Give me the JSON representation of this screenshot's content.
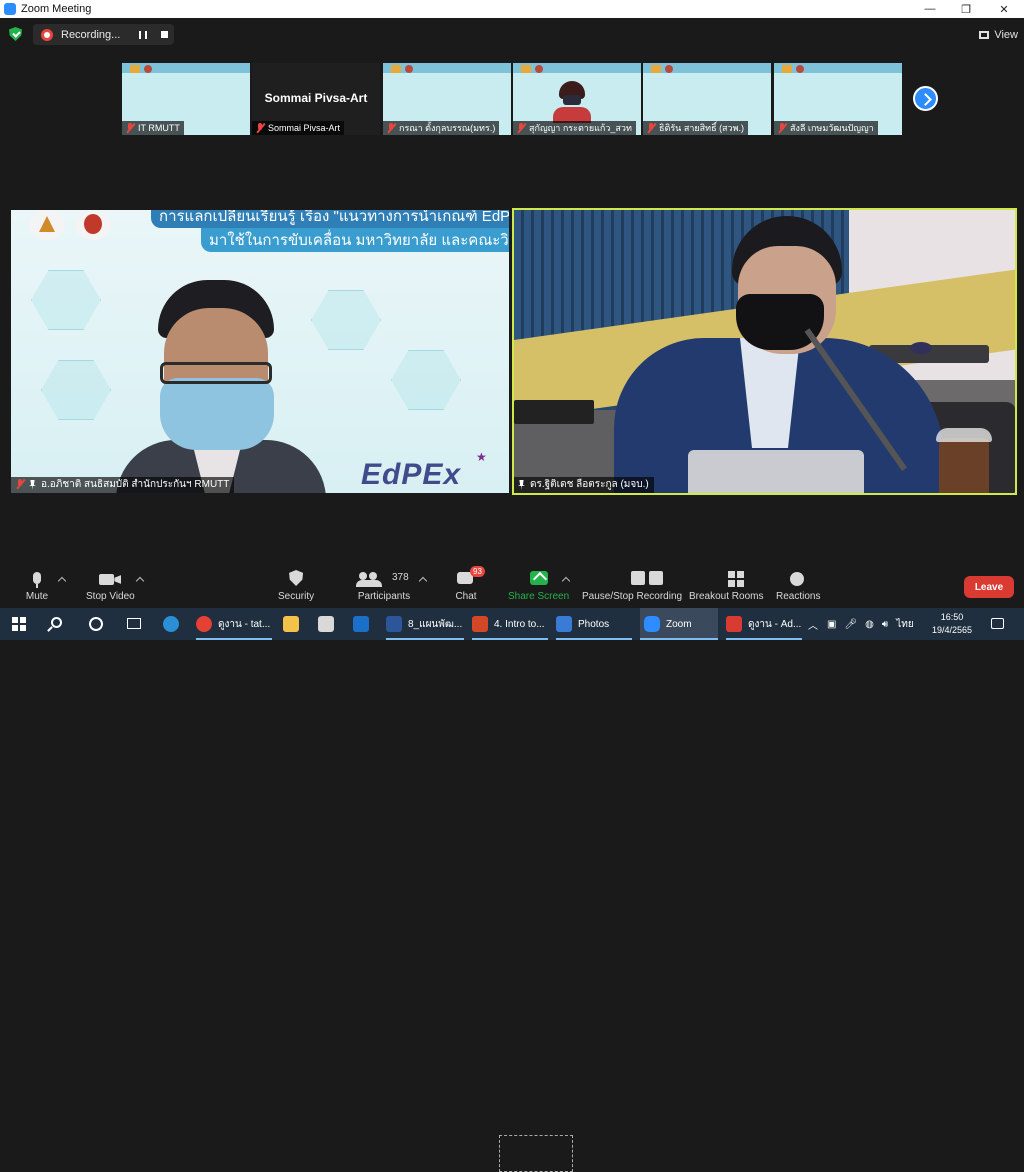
{
  "window": {
    "title": "Zoom Meeting",
    "minimize": "—",
    "maximize": "❐",
    "close": "✕"
  },
  "meeting_bar": {
    "recording_label": "Recording...",
    "view_label": "View"
  },
  "gallery": {
    "thumbnails": [
      {
        "name": "IT RMUTT",
        "type": "slide"
      },
      {
        "name": "Sommai Pivsa-Art",
        "type": "name-only",
        "display_name": "Sommai Pivsa-Art"
      },
      {
        "name": "กรณา ตั้งกุลบรรณ(มทร.)",
        "type": "slide"
      },
      {
        "name": "สุกัญญา กระตายแก้ว_สวท",
        "type": "person"
      },
      {
        "name": "ธิติรัน สายสิทธิ์ (สวพ.)",
        "type": "slide"
      },
      {
        "name": "สังลี เกษมวัฒนปัญญา",
        "type": "slide"
      }
    ]
  },
  "main_left": {
    "name": "อ.อภิชาติ สนธิสมบัติ สำนักประกันฯ RMUTT",
    "slide_line1": "การแลกเปลี่ยนเรียนรู้ เรื่อง \"แนวทางการนำเกณฑ์ EdPEx",
    "slide_line2": "มาใช้ในการขับเคลื่อน มหาวิทยาลัย และคณะวิชา\"",
    "slide_logo_text": "EdPEx"
  },
  "main_right": {
    "name": "ดร.ฐิติเดช ลือตระกูล (มจบ.)"
  },
  "toolbar": {
    "mute": "Mute",
    "stop_video": "Stop Video",
    "security": "Security",
    "participants": "Participants",
    "participants_count": "378",
    "chat": "Chat",
    "chat_badge": "93",
    "share_screen": "Share Screen",
    "pause_stop_recording": "Pause/Stop Recording",
    "breakout_rooms": "Breakout Rooms",
    "reactions": "Reactions",
    "leave": "Leave"
  },
  "taskbar": {
    "apps": [
      {
        "label": "ดูงาน - tat...",
        "color": "#e44134"
      },
      {
        "label": "8_แผนพัฒ...",
        "color": "#2b579a"
      },
      {
        "label": "4. Intro to...",
        "color": "#d24726"
      },
      {
        "label": "Photos",
        "color": "#3a7bd5"
      },
      {
        "label": "Zoom",
        "color": "#2d8cff"
      },
      {
        "label": "ดูงาน - Ad...",
        "color": "#d93b33"
      }
    ],
    "language": "ไทย",
    "time": "16:50",
    "date": "19/4/2565"
  }
}
